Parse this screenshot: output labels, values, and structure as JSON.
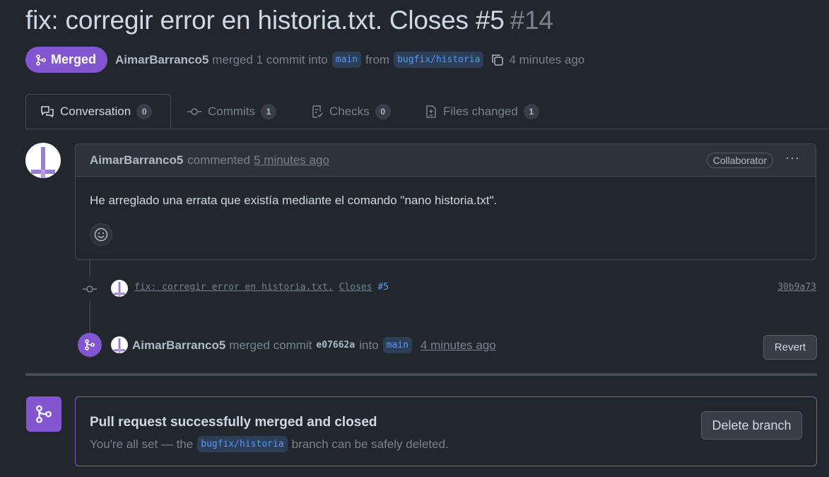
{
  "pr": {
    "title": "fix: corregir error en historia.txt. Closes #5",
    "number": "#14",
    "state_label": "Merged",
    "author": "AimarBarranco5",
    "merge_text_1": "merged 1 commit into",
    "base_branch": "main",
    "from_text": "from",
    "head_branch": "bugfix/historia",
    "time_ago": "4 minutes ago"
  },
  "tabs": [
    {
      "label": "Conversation",
      "count": "0"
    },
    {
      "label": "Commits",
      "count": "1"
    },
    {
      "label": "Checks",
      "count": "0"
    },
    {
      "label": "Files changed",
      "count": "1"
    }
  ],
  "comment": {
    "author": "AimarBarranco5",
    "action": "commented",
    "time": "5 minutes ago",
    "role_badge": "Collaborator",
    "body": "He arreglado una errata que existía mediante el comando \"nano historia.txt\"."
  },
  "commit": {
    "message": "fix: corregir error en historia.txt.",
    "closes": "Closes",
    "issue": "#5",
    "sha": "30b9a73"
  },
  "merge_event": {
    "author": "AimarBarranco5",
    "text": "merged commit",
    "sha": "e07662a",
    "into": "into",
    "branch": "main",
    "time": "4 minutes ago",
    "revert_label": "Revert"
  },
  "merge_box": {
    "title": "Pull request successfully merged and closed",
    "sub_before": "You're all set — the",
    "branch": "bugfix/historia",
    "sub_after": "branch can be safely deleted.",
    "delete_label": "Delete branch"
  },
  "colors": {
    "merged_purple": "#8256d0",
    "link_blue": "#539bf5",
    "background": "#22272e"
  }
}
